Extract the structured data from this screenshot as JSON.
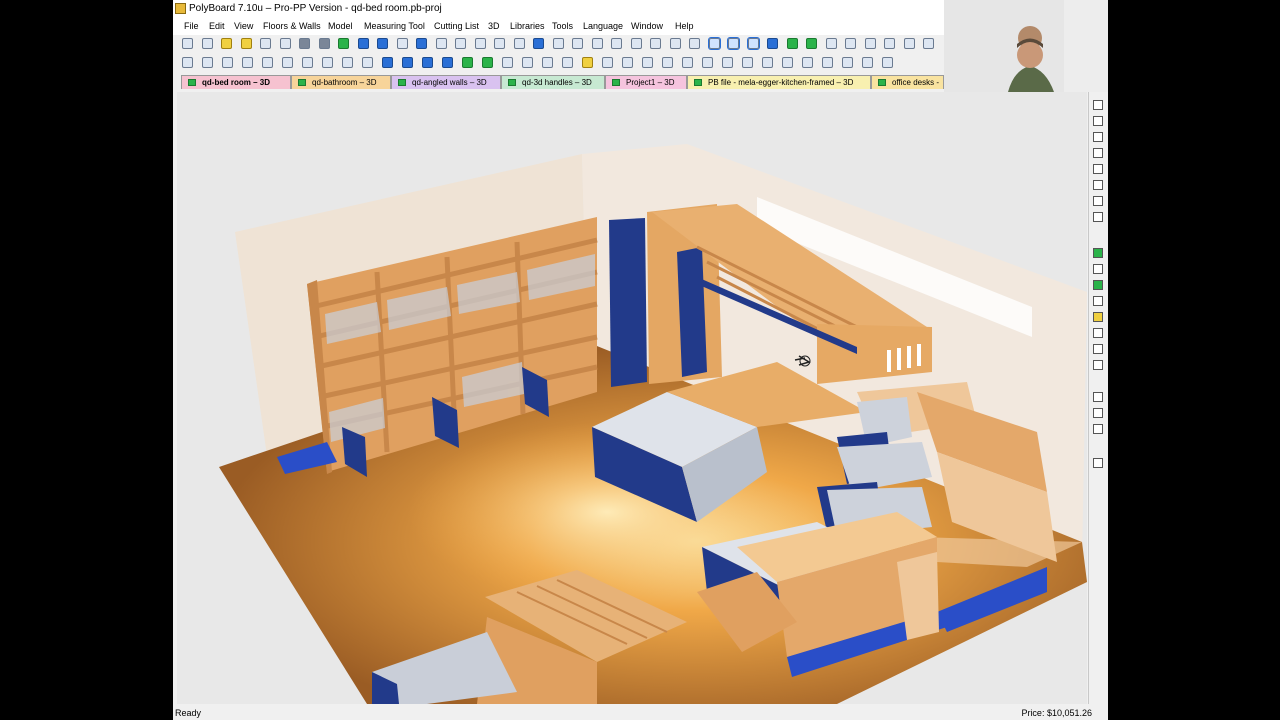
{
  "window": {
    "title": "PolyBoard 7.10u – Pro-PP Version - qd-bed room.pb-proj"
  },
  "menu": [
    "File",
    "Edit",
    "View",
    "Floors & Walls",
    "Model",
    "Measuring Tool",
    "Cutting List",
    "3D",
    "Libraries",
    "Tools",
    "Language",
    "Window",
    "Help"
  ],
  "tabs": [
    {
      "label": "qd-bed room – 3D",
      "color": "#f6c2d0",
      "active": true
    },
    {
      "label": "qd-bathroom – 3D",
      "color": "#f7d49a",
      "active": false
    },
    {
      "label": "qd-angled walls – 3D",
      "color": "#d9c2f0",
      "active": false
    },
    {
      "label": "qd-3d handles – 3D",
      "color": "#c7e9d2",
      "active": false
    },
    {
      "label": "Project1 – 3D",
      "color": "#f5c4de",
      "active": false
    },
    {
      "label": "PB file - mela-egger-kitchen-framed – 3D",
      "color": "#f8f0b0",
      "active": false
    },
    {
      "label": "office desks -",
      "color": "#f9e3a0",
      "active": false
    }
  ],
  "status": {
    "left": "Ready",
    "right": "Price: $10,051.26"
  },
  "colors": {
    "wood": "#e6a964",
    "panel_blue": "#223a8a",
    "floor": "#a3642a",
    "wall": "#f0e3d4",
    "background": "#e8e8e8"
  }
}
